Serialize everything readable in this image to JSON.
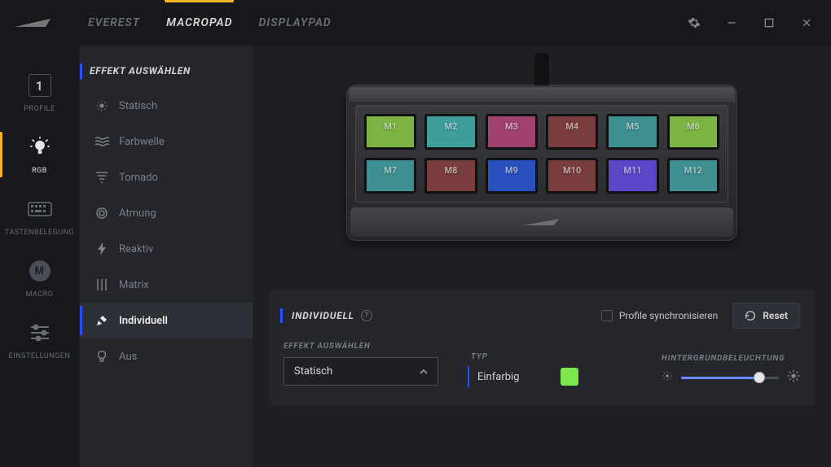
{
  "header": {
    "tabs": [
      {
        "label": "EVEREST",
        "active": false
      },
      {
        "label": "MACROPAD",
        "active": true
      },
      {
        "label": "DISPLAYPAD",
        "active": false
      }
    ]
  },
  "rail": {
    "items": [
      {
        "icon": "profile-number",
        "label": "PROFILE",
        "value": "1",
        "active": false
      },
      {
        "icon": "lightbulb",
        "label": "RGB",
        "active": true
      },
      {
        "icon": "keyboard",
        "label": "TASTENBELEGUNG",
        "active": false
      },
      {
        "icon": "macro-m",
        "label": "MACRO",
        "active": false
      },
      {
        "icon": "sliders",
        "label": "EINSTELLUNGEN",
        "active": false
      }
    ]
  },
  "effect_panel": {
    "header": "EFFEKT AUSWÄHLEN",
    "items": [
      {
        "icon": "sun",
        "label": "Statisch"
      },
      {
        "icon": "waves",
        "label": "Farbwelle"
      },
      {
        "icon": "tornado",
        "label": "Tornado"
      },
      {
        "icon": "target",
        "label": "Atmung"
      },
      {
        "icon": "bolt",
        "label": "Reaktiv"
      },
      {
        "icon": "matrix",
        "label": "Matrix"
      },
      {
        "icon": "custom",
        "label": "Individuell",
        "active": true
      },
      {
        "icon": "bulb-off",
        "label": "Aus"
      }
    ]
  },
  "device": {
    "keys": [
      {
        "label": "M1",
        "color": "#7db342"
      },
      {
        "label": "M2",
        "color": "#3f9e9a"
      },
      {
        "label": "M3",
        "color": "#a0416f"
      },
      {
        "label": "M4",
        "color": "#7a3d3d"
      },
      {
        "label": "M5",
        "color": "#3f8f92"
      },
      {
        "label": "M6",
        "color": "#7db342"
      },
      {
        "label": "M7",
        "color": "#3f8f92"
      },
      {
        "label": "M8",
        "color": "#7a3d3d"
      },
      {
        "label": "M9",
        "color": "#2a4fbf"
      },
      {
        "label": "M10",
        "color": "#7a3d3d"
      },
      {
        "label": "M11",
        "color": "#5a46c7"
      },
      {
        "label": "M12",
        "color": "#3f8f92"
      }
    ]
  },
  "config": {
    "title": "INDIVIDUELL",
    "sync_label": "Profile synchronisieren",
    "reset_label": "Reset",
    "effect_label": "EFFEKT AUSWÄHLEN",
    "effect_value": "Statisch",
    "type_label": "TYP",
    "type_value": "Einfarbig",
    "type_color": "#7de64a",
    "backlight_label": "HINTERGRUNDBELEUCHTUNG",
    "backlight_value": 80
  }
}
